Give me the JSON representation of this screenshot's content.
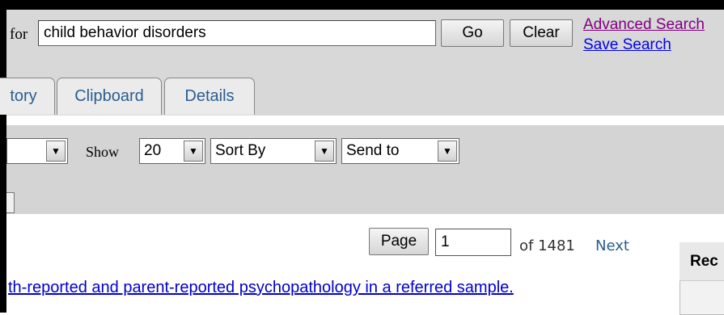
{
  "search": {
    "for_label": "for",
    "query_value": "child behavior disorders",
    "go_label": "Go",
    "clear_label": "Clear",
    "advanced_search_label": "Advanced Search",
    "save_search_label": "Save Search"
  },
  "tabs": [
    {
      "label": "tory"
    },
    {
      "label": "Clipboard"
    },
    {
      "label": "Details"
    }
  ],
  "display": {
    "format_value": "",
    "show_label": "Show",
    "show_value": "20",
    "sort_value": "Sort By",
    "send_value": "Send to"
  },
  "pager": {
    "page_label": "Page",
    "page_value": "1",
    "of_text": "of 1481",
    "next_label": "Next"
  },
  "recent": {
    "title": "Rec"
  },
  "results": [
    {
      "title": "th-reported and parent-reported psychopathology in a referred sample."
    }
  ]
}
